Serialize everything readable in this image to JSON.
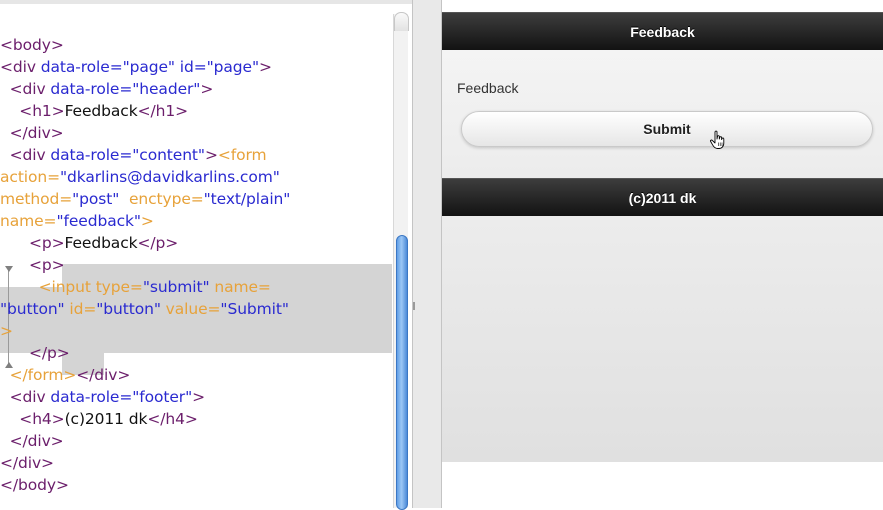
{
  "code": {
    "lines": [
      [
        {
          "c": "t",
          "v": "<body>"
        }
      ],
      [
        {
          "c": "t",
          "v": "<div "
        },
        {
          "c": "s",
          "v": "data-role=\"page\" id=\"page\""
        },
        {
          "c": "t",
          "v": ">"
        }
      ],
      [
        {
          "c": "t",
          "v": "  <div "
        },
        {
          "c": "s",
          "v": "data-role=\"header\""
        },
        {
          "c": "t",
          "v": ">"
        }
      ],
      [
        {
          "c": "t",
          "v": "    <h1>"
        },
        {
          "c": "p",
          "v": "Feedback"
        },
        {
          "c": "t",
          "v": "</h1>"
        }
      ],
      [
        {
          "c": "t",
          "v": "  </div>"
        }
      ],
      [
        {
          "c": "t",
          "v": "  <div "
        },
        {
          "c": "s",
          "v": "data-role=\"content\""
        },
        {
          "c": "t",
          "v": ">"
        },
        {
          "c": "o",
          "v": "<form"
        }
      ],
      [
        {
          "c": "o",
          "v": "action="
        },
        {
          "c": "s",
          "v": "\"dkarlins@davidkarlins.com\""
        }
      ],
      [
        {
          "c": "o",
          "v": "method="
        },
        {
          "c": "s",
          "v": "\"post\""
        },
        {
          "c": "o",
          "v": "  enctype="
        },
        {
          "c": "s",
          "v": "\"text/plain\""
        }
      ],
      [
        {
          "c": "o",
          "v": "name="
        },
        {
          "c": "s",
          "v": "\"feedback\""
        },
        {
          "c": "o",
          "v": ">"
        }
      ],
      [
        {
          "c": "t",
          "v": "      <p>"
        },
        {
          "c": "p",
          "v": "Feedback"
        },
        {
          "c": "t",
          "v": "</p>"
        }
      ],
      [
        {
          "c": "t",
          "v": "      <p>"
        }
      ],
      [
        {
          "c": "o",
          "v": "        <input "
        },
        {
          "c": "o",
          "v": "type="
        },
        {
          "c": "s",
          "v": "\"submit\""
        },
        {
          "c": "o",
          "v": " name="
        }
      ],
      [
        {
          "c": "s",
          "v": "\"button\""
        },
        {
          "c": "o",
          "v": " id="
        },
        {
          "c": "s",
          "v": "\"button\""
        },
        {
          "c": "o",
          "v": " value="
        },
        {
          "c": "s",
          "v": "\"Submit\""
        }
      ],
      [
        {
          "c": "o",
          "v": ">"
        }
      ],
      [
        {
          "c": "t",
          "v": "      </p>"
        }
      ],
      [
        {
          "c": "o",
          "v": "  </form>"
        },
        {
          "c": "t",
          "v": "</div>"
        }
      ],
      [
        {
          "c": "t",
          "v": "  <div "
        },
        {
          "c": "s",
          "v": "data-role=\"footer\""
        },
        {
          "c": "t",
          "v": ">"
        }
      ],
      [
        {
          "c": "t",
          "v": "    <h4>"
        },
        {
          "c": "p",
          "v": "(c)2011 dk"
        },
        {
          "c": "t",
          "v": "</h4>"
        }
      ],
      [
        {
          "c": "t",
          "v": "  </div>"
        }
      ],
      [
        {
          "c": "t",
          "v": "</div>"
        }
      ],
      [
        {
          "c": "t",
          "v": "</body>"
        }
      ]
    ]
  },
  "preview": {
    "header_title": "Feedback",
    "content_text": "Feedback",
    "submit_label": "Submit",
    "footer_title": "(c)2011 dk"
  },
  "colors": {
    "tag": "#6b1e6b",
    "form_tag": "#e7a23a",
    "attr_value": "#2a2ad0",
    "selection": "#d4d4d4",
    "scrollbar_thumb": "#6aa8ec",
    "bar_dark": "#1a1a1a"
  },
  "icons": {
    "cursor": "hand-pointer-icon"
  }
}
